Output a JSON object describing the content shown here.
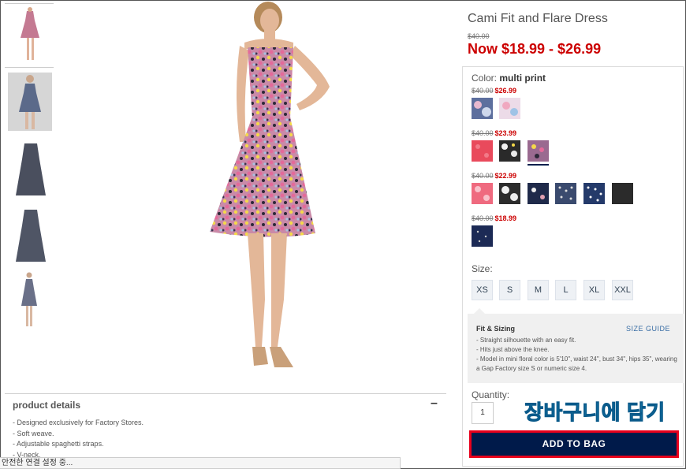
{
  "product": {
    "title": "Cami Fit and Flare Dress",
    "original_price": "$40.00",
    "now_price": "Now $18.99 - $26.99"
  },
  "color": {
    "label": "Color:",
    "selected": "multi print",
    "groups": [
      {
        "original": "$40.00",
        "sale": "$26.99",
        "swatches": [
          "#6a7fae",
          "#e9d4e6"
        ]
      },
      {
        "original": "$40.00",
        "sale": "$23.99",
        "swatches": [
          "#e94a5c",
          "#2a2a2a",
          "#8a6a8f"
        ]
      },
      {
        "original": "$40.00",
        "sale": "$22.99",
        "swatches": [
          "#ef6a7f",
          "#2c2c2c",
          "#1f2a4a",
          "#3a4a6e",
          "#243a6a",
          "#2b2b2b"
        ]
      },
      {
        "original": "$40.00",
        "sale": "$18.99",
        "swatches": [
          "#1c2a55"
        ]
      }
    ]
  },
  "size": {
    "label": "Size:",
    "options": [
      "XS",
      "S",
      "M",
      "L",
      "XL",
      "XXL"
    ]
  },
  "fit": {
    "title": "Fit & Sizing",
    "guide_link": "SIZE GUIDE",
    "bullets": [
      "- Straight silhouette with an easy fit.",
      "- Hits just above the knee.",
      "- Model in mini floral color is 5'10\", waist 24\", bust 34\", hips 35\", wearing a Gap Factory size S or numeric size 4."
    ]
  },
  "quantity": {
    "label": "Quantity:",
    "value": "1"
  },
  "annotation": "장바구니에 담기",
  "add_to_bag": "ADD TO BAG",
  "details": {
    "title": "product details",
    "toggle": "–",
    "bullets": [
      "- Designed exclusively for Factory Stores.",
      "- Soft weave.",
      "- Adjustable spaghetti straps.",
      "- V-neck."
    ]
  },
  "status_bar": "안전한 연결 설정 중..."
}
